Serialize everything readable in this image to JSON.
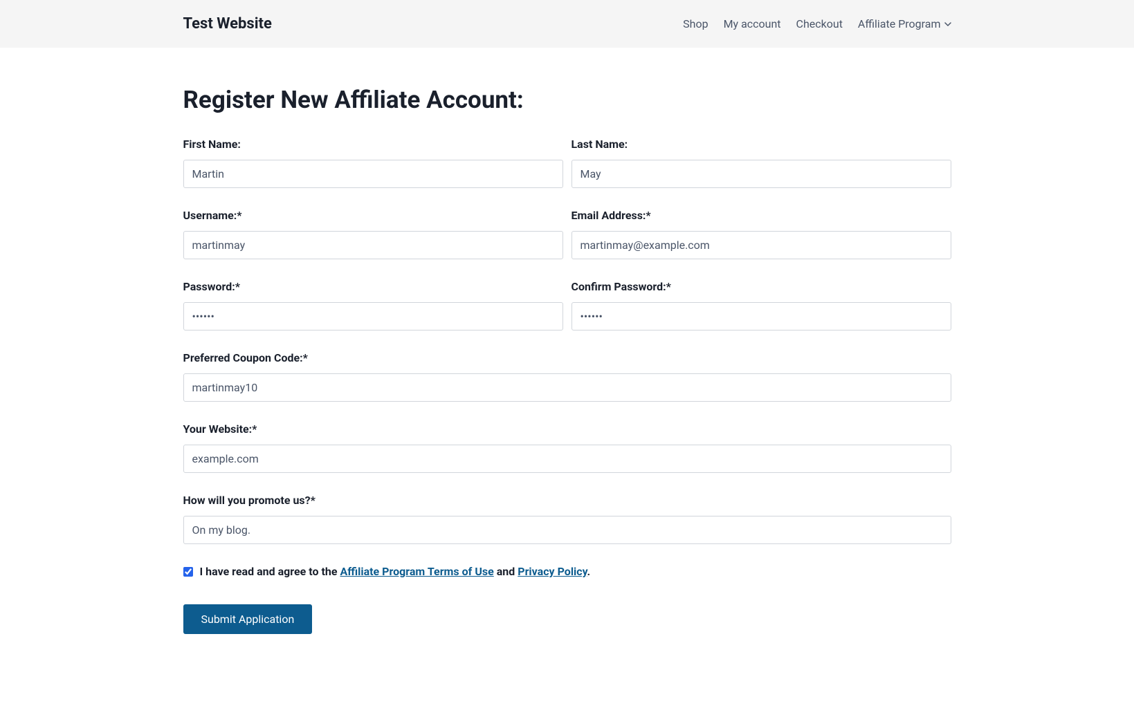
{
  "header": {
    "site_title": "Test Website",
    "nav": {
      "shop": "Shop",
      "my_account": "My account",
      "checkout": "Checkout",
      "affiliate_program": "Affiliate Program"
    }
  },
  "page": {
    "title": "Register New Affiliate Account:"
  },
  "form": {
    "first_name": {
      "label": "First Name:",
      "value": "Martin"
    },
    "last_name": {
      "label": "Last Name:",
      "value": "May"
    },
    "username": {
      "label": "Username:*",
      "value": "martinmay"
    },
    "email": {
      "label": "Email Address:*",
      "value": "martinmay@example.com"
    },
    "password": {
      "label": "Password:*",
      "value": "••••••"
    },
    "confirm_password": {
      "label": "Confirm Password:*",
      "value": "••••••"
    },
    "coupon": {
      "label": "Preferred Coupon Code:*",
      "value": "martinmay10"
    },
    "website": {
      "label": "Your Website:*",
      "value": "example.com"
    },
    "promote": {
      "label": "How will you promote us?*",
      "value": "On my blog."
    },
    "terms": {
      "prefix": "I have read and agree to the ",
      "link1": "Affiliate Program Terms of Use",
      "mid": " and ",
      "link2": "Privacy Policy",
      "suffix": "."
    },
    "submit": "Submit Application"
  }
}
